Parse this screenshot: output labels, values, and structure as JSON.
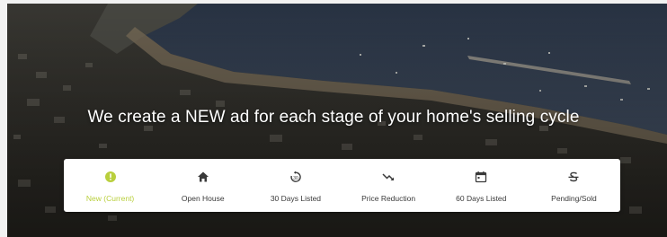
{
  "hero": {
    "headline": "We create a NEW ad for each stage of your home's selling cycle"
  },
  "colors": {
    "accent": "#b9cf3c",
    "icon": "#3a3a3a"
  },
  "stages": [
    {
      "label": "New (Current)",
      "icon": "exclamation-circle-icon",
      "active": true
    },
    {
      "label": "Open House",
      "icon": "home-icon",
      "active": false
    },
    {
      "label": "30 Days Listed",
      "icon": "timer-icon",
      "active": false
    },
    {
      "label": "Price Reduction",
      "icon": "trending-down-icon",
      "active": false
    },
    {
      "label": "60 Days Listed",
      "icon": "calendar-icon",
      "active": false
    },
    {
      "label": "Pending/Sold",
      "icon": "strikethrough-icon",
      "active": false
    }
  ]
}
